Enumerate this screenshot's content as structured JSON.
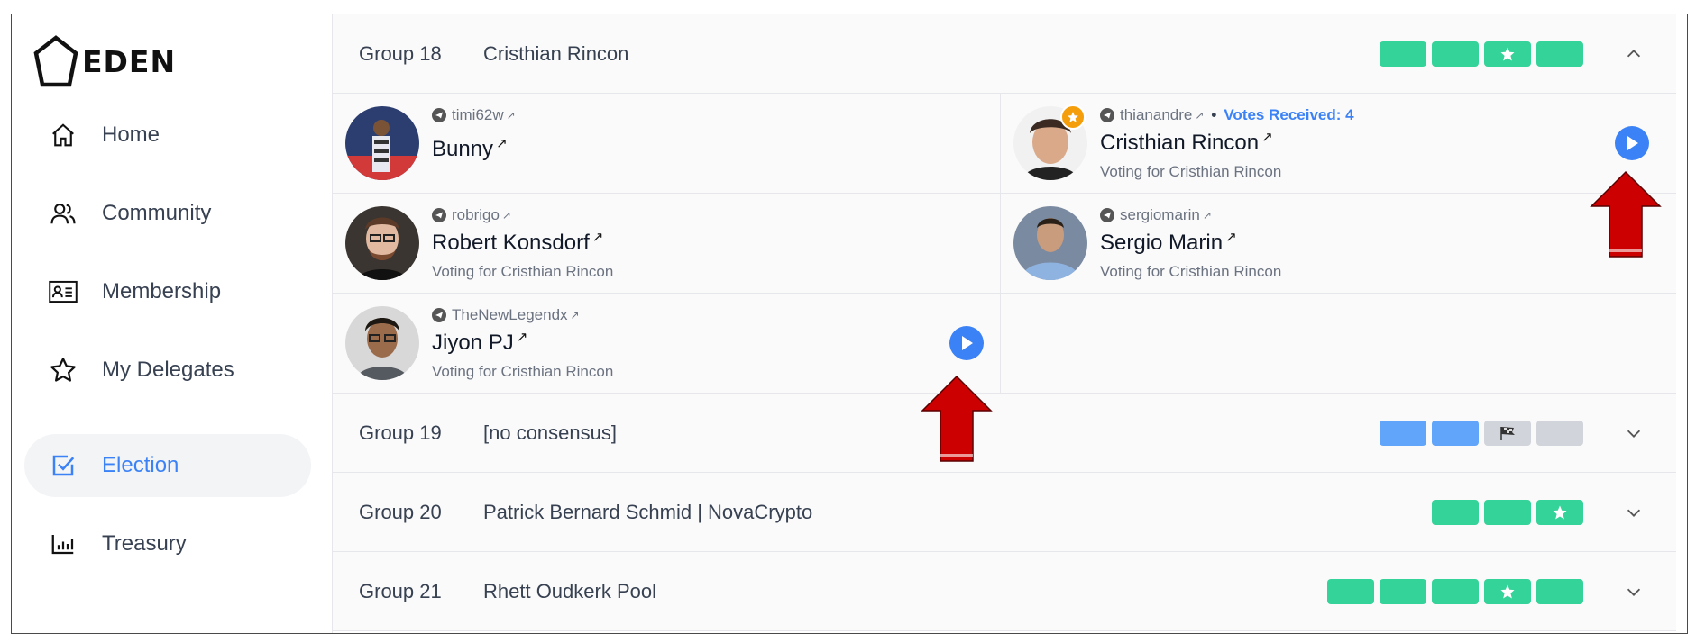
{
  "app": {
    "logo_text": "EDEN"
  },
  "sidebar": {
    "items": [
      {
        "label": "Home",
        "icon": "home-icon",
        "active": false
      },
      {
        "label": "Community",
        "icon": "users-icon",
        "active": false
      },
      {
        "label": "Membership",
        "icon": "id-card-icon",
        "active": false
      },
      {
        "label": "My Delegates",
        "icon": "star-icon",
        "active": false
      },
      {
        "label": "Election",
        "icon": "checkbox-icon",
        "active": true
      },
      {
        "label": "Treasury",
        "icon": "chart-icon",
        "active": false
      }
    ]
  },
  "groups": [
    {
      "name": "Group 18",
      "leader": "Cristhian Rincon",
      "expanded": true,
      "pills": [
        "green",
        "green",
        "green-star",
        "green"
      ],
      "members": [
        {
          "handle": "timi62w",
          "name": "Bunny",
          "voting": ""
        },
        {
          "handle": "thianandre",
          "name": "Cristhian Rincon",
          "voting": "Voting for Cristhian Rincon",
          "votes": "Votes Received: 4",
          "delegate": true
        },
        {
          "handle": "robrigo",
          "name": "Robert Konsdorf",
          "voting": "Voting for Cristhian Rincon"
        },
        {
          "handle": "sergiomarin",
          "name": "Sergio Marin",
          "voting": "Voting for Cristhian Rincon"
        },
        {
          "handle": "TheNewLegendx",
          "name": "Jiyon PJ",
          "voting": "Voting for Cristhian Rincon"
        }
      ]
    },
    {
      "name": "Group 19",
      "leader": "[no consensus]",
      "expanded": false,
      "pills": [
        "blue",
        "blue",
        "gray-flag",
        "gray"
      ]
    },
    {
      "name": "Group 20",
      "leader": "Patrick Bernard Schmid | NovaCrypto",
      "expanded": false,
      "pills": [
        "green",
        "green",
        "green-star"
      ]
    },
    {
      "name": "Group 21",
      "leader": "Rhett Oudkerk Pool",
      "expanded": false,
      "pills": [
        "green",
        "green",
        "green",
        "green-star",
        "green"
      ]
    }
  ],
  "colors": {
    "green": "#34d399",
    "blue": "#60a5fa",
    "gray": "#d1d5db",
    "accent": "#3b82f6",
    "arrow": "#cc0000"
  }
}
